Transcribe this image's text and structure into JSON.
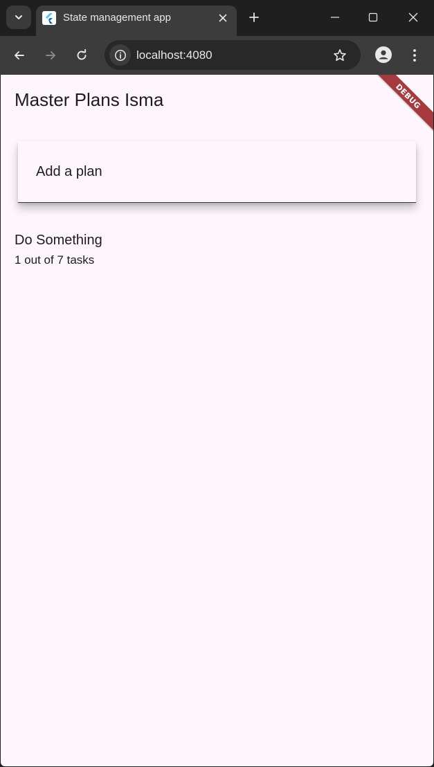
{
  "browser": {
    "tab": {
      "title": "State management app"
    },
    "omnibox": {
      "url": "localhost:4080"
    },
    "icons": {
      "tab_search": "chevron-down-icon",
      "favicon": "flutter-icon",
      "tab_close": "close-icon",
      "new_tab": "plus-icon",
      "minimize": "minimize-icon",
      "maximize": "maximize-icon",
      "close_window": "close-icon",
      "back": "arrow-left-icon",
      "forward": "arrow-right-icon",
      "reload": "reload-icon",
      "site_info": "info-icon",
      "bookmark": "star-icon",
      "profile": "person-icon",
      "menu": "more-vertical-icon"
    }
  },
  "app": {
    "title": "Master Plans Isma",
    "debug_banner": "DEBUG",
    "add_plan": {
      "placeholder": "Add a plan",
      "value": ""
    },
    "plans": [
      {
        "name": "Do Something",
        "subtitle": "1 out of 7 tasks"
      }
    ]
  },
  "colors": {
    "page_background": "#fdf7fd",
    "browser_frame": "#1f1f1f",
    "toolbar": "#3c3c3c",
    "debug_banner": "#a63a3f",
    "text": "#1d1b20"
  }
}
